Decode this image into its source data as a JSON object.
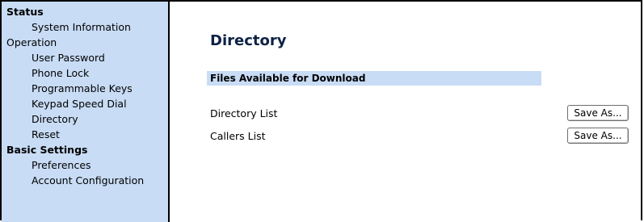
{
  "sidebar": {
    "sections": [
      {
        "label": "Status",
        "items": [
          "System Information"
        ]
      },
      {
        "label": "Operation",
        "items": [
          "User Password",
          "Phone Lock",
          "Programmable Keys",
          "Keypad Speed Dial",
          "Directory",
          "Reset"
        ]
      },
      {
        "label": "Basic Settings",
        "items": [
          "Preferences",
          "Account Configuration"
        ]
      }
    ]
  },
  "main": {
    "title": "Directory",
    "files_header": "Files Available for Download",
    "files": [
      {
        "label": "Directory List",
        "button": "Save As..."
      },
      {
        "label": "Callers List",
        "button": "Save As..."
      }
    ]
  },
  "colors": {
    "sidebar_bg": "#c8dcf5",
    "title": "#0d2245"
  }
}
